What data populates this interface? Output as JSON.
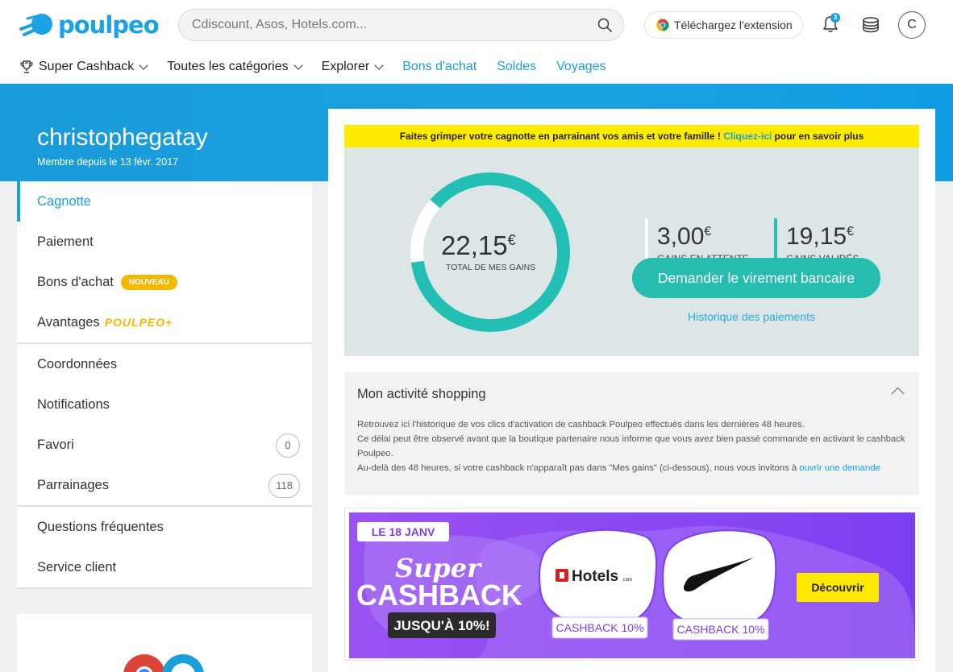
{
  "brand": {
    "name": "poulpeo"
  },
  "search": {
    "placeholder": "Cdiscount, Asos, Hotels.com..."
  },
  "header": {
    "extension_label": "Téléchargez l'extension",
    "notification_count": "3",
    "avatar_initial": "C"
  },
  "nav": {
    "items": [
      {
        "label": "Super Cashback"
      },
      {
        "label": "Toutes les catégories"
      },
      {
        "label": "Explorer"
      },
      {
        "label": "Bons d'achat"
      },
      {
        "label": "Soldes"
      },
      {
        "label": "Voyages"
      }
    ]
  },
  "profile": {
    "username": "christophegatay",
    "member_since": "Membre depuis le 13 févr. 2017"
  },
  "sidebar": {
    "items": [
      {
        "label": "Cagnotte"
      },
      {
        "label": "Paiement"
      },
      {
        "label": "Bons d'achat",
        "badge": "NOUVEAU"
      },
      {
        "label": "Avantages",
        "badge": "POULPEO+"
      },
      {
        "label": "Coordonnées"
      },
      {
        "label": "Notifications"
      },
      {
        "label": "Favori",
        "count": "0"
      },
      {
        "label": "Parrainages",
        "count": "118"
      },
      {
        "label": "Questions fréquentes"
      },
      {
        "label": "Service client"
      }
    ]
  },
  "promo": {
    "text_before": "Faites grimper votre cagnotte en parrainant vos amis et votre famille ! ",
    "link": "Cliquez-ici",
    "text_after": " pour en savoir plus"
  },
  "gains": {
    "total_value": "22,15",
    "total_currency": "€",
    "total_label": "TOTAL DE MES GAINS",
    "validated_fraction": 0.8645,
    "pending_value": "3,00",
    "pending_currency": "€",
    "pending_label": "GAINS EN ATTENTE",
    "validated_value": "19,15",
    "validated_currency": "€",
    "validated_label": "GAINS VALIDÉS",
    "transfer_button": "Demander le virement bancaire",
    "history_link": "Historique des paiements"
  },
  "activity": {
    "title": "Mon activité shopping",
    "line1": "Retrouvez ici l'historique de vos clics d'activation de cashback Poulpeo effectués dans les dernières 48 heures.",
    "line2": "Ce délai peut être observé avant que la boutique partenaire nous informe que vous avez bien passé commande en activant le cashback Poulpeo.",
    "line3": "Au-delà des 48 heures, si votre cashback n'apparaît pas dans \"Mes gains\" (ci-dessous), nous vous invitons à ",
    "link": "ouvrir une demande"
  },
  "banner": {
    "date": "LE 18 JANV",
    "super": "Super",
    "cashback": "CASHBACK",
    "upto": "JUSQU'À 10%!",
    "hotels_name": "Hotels",
    "hotels_suffix": ".com",
    "hotels_cashback": "CASHBACK 10%",
    "nike_cashback": "CASHBACK 10%",
    "cta": "Découvrir"
  },
  "colors": {
    "brand_blue": "#1a9fd9",
    "teal": "#26bcb0",
    "yellow": "#ffeb00",
    "banner_purple": "#8a45f0"
  }
}
